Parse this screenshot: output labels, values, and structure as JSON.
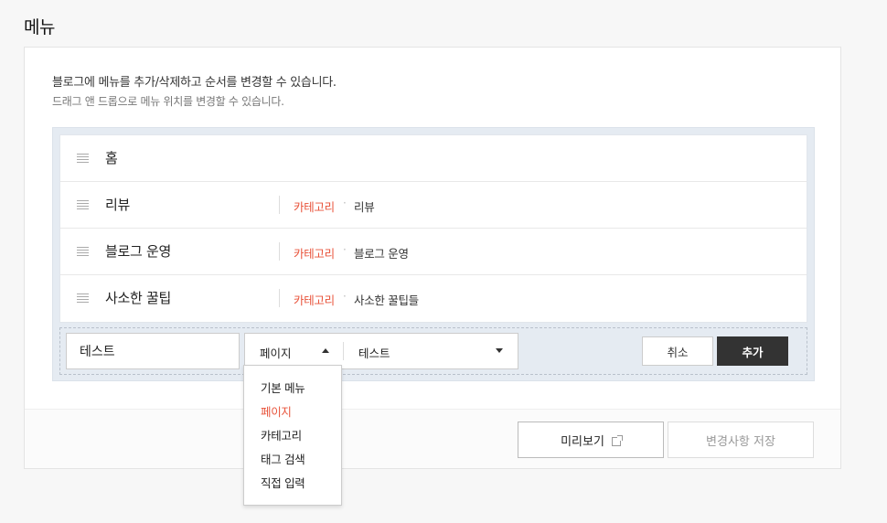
{
  "page": {
    "title": "메뉴"
  },
  "description": {
    "line1": "블로그에 메뉴를 추가/삭제하고 순서를 변경할 수 있습니다.",
    "line2": "드래그 앤 드롭으로 메뉴 위치를 변경할 수 있습니다."
  },
  "menu_items": [
    {
      "name": "홈",
      "type": "",
      "target": ""
    },
    {
      "name": "리뷰",
      "type": "카테고리",
      "target": "리뷰"
    },
    {
      "name": "블로그 운영",
      "type": "카테고리",
      "target": "블로그 운영"
    },
    {
      "name": "사소한 꿀팁",
      "type": "카테고리",
      "target": "사소한 꿀팁들"
    }
  ],
  "separator": "·",
  "add_form": {
    "name_value": "테스트",
    "type_selected": "페이지",
    "target_selected": "테스트",
    "cancel_label": "취소",
    "add_label": "추가"
  },
  "type_options": [
    "기본 메뉴",
    "페이지",
    "카테고리",
    "태그 검색",
    "직접 입력"
  ],
  "footer": {
    "preview_label": "미리보기",
    "save_label": "변경사항 저장"
  },
  "colors": {
    "accent": "#e8533a",
    "dark_button": "#333333",
    "menu_box_bg": "#e5ebf2"
  },
  "icons": [
    "drag-handle-icon",
    "caret-up-icon",
    "caret-down-icon",
    "external-link-icon"
  ]
}
